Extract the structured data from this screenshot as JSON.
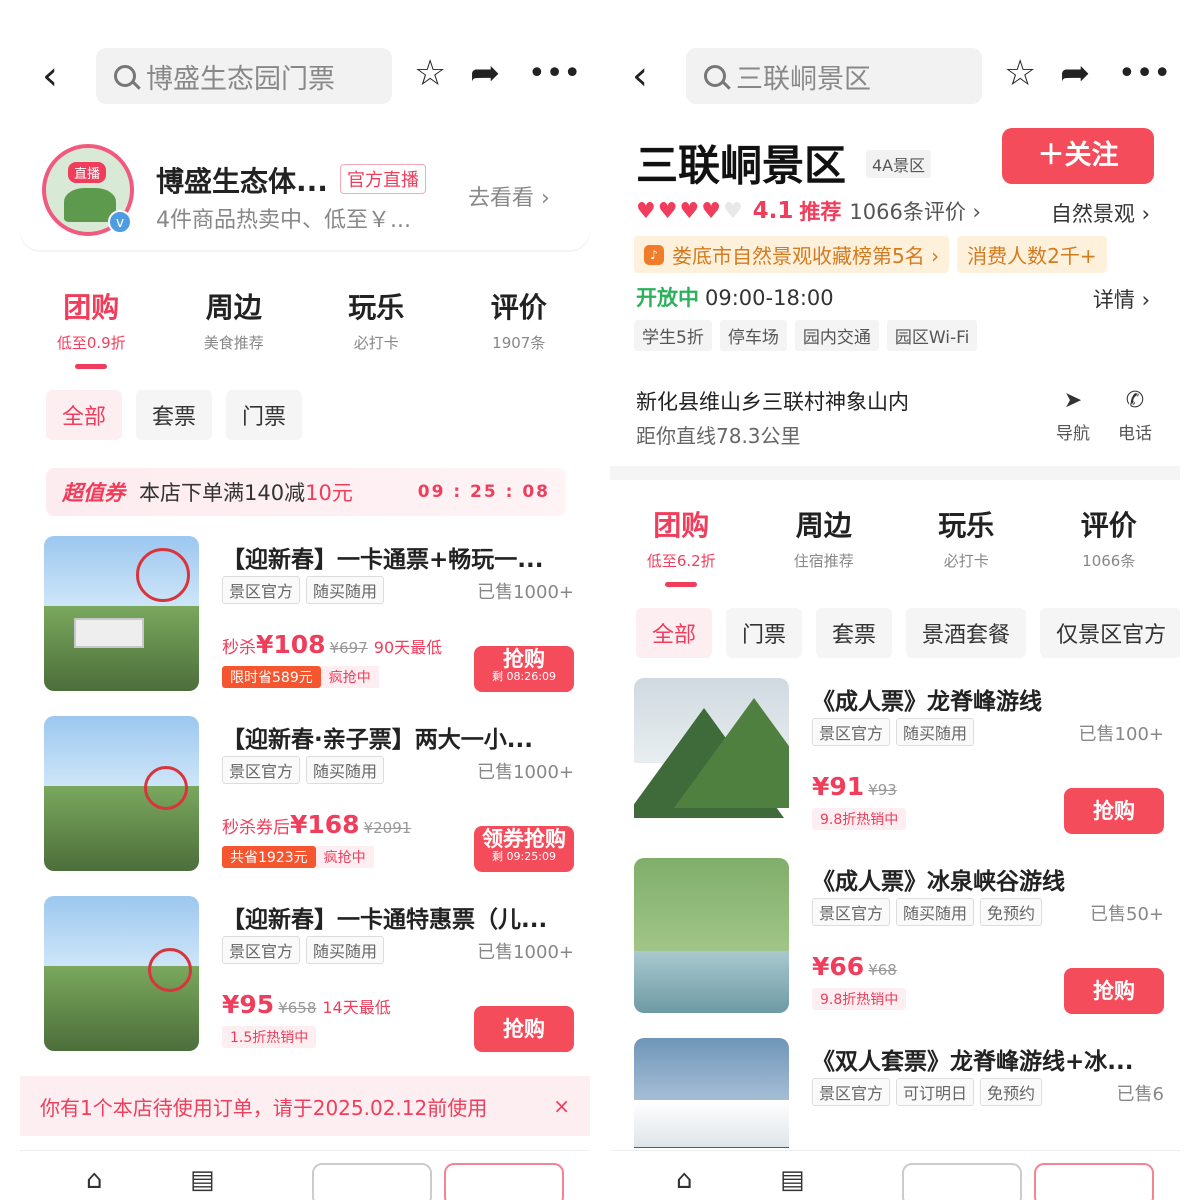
{
  "left": {
    "search_text": "博盛生态园门票",
    "live": {
      "badge": "直播",
      "title": "博盛生态体...",
      "tag": "官方直播",
      "subtitle": "4件商品热卖中、低至￥...",
      "go": "去看看 ›"
    },
    "tabs": [
      {
        "label": "团购",
        "sub": "低至0.9折"
      },
      {
        "label": "周边",
        "sub": "美食推荐"
      },
      {
        "label": "玩乐",
        "sub": "必打卡"
      },
      {
        "label": "评价",
        "sub": "1907条"
      }
    ],
    "filters": [
      "全部",
      "套票",
      "门票"
    ],
    "coupon": {
      "brand": "超值券",
      "text": "本店下单满140减",
      "amount": "10元",
      "timer": "09 : 25 : 08"
    },
    "products": [
      {
        "title": "【迎新春】一卡通票+畅玩一...",
        "tags": [
          "景区官方",
          "随买随用"
        ],
        "sold": "已售1000+",
        "price_prefix": "秒杀",
        "price": "¥108",
        "old": "¥697",
        "note": "90天最低",
        "badge1": "限时省589元",
        "badge2": "疯抢中",
        "buy": "抢购",
        "buy_sub": "剩 08:26:09"
      },
      {
        "title": "【迎新春·亲子票】两大一小...",
        "tags": [
          "景区官方",
          "随买随用"
        ],
        "sold": "已售1000+",
        "price_prefix": "秒杀券后",
        "price": "¥168",
        "old": "¥2091",
        "note": "",
        "badge1": "共省1923元",
        "badge2": "疯抢中",
        "buy": "领券抢购",
        "buy_sub": "剩 09:25:09"
      },
      {
        "title": "【迎新春】一卡通特惠票（儿...",
        "tags": [
          "景区官方",
          "随买随用"
        ],
        "sold": "已售1000+",
        "price_prefix": "",
        "price": "¥95",
        "old": "¥658",
        "note": "14天最低",
        "badge1": "1.5折热销中",
        "buy": "抢购"
      }
    ],
    "notice": "你有1个本店待使用订单，请于2025.02.12前使用",
    "close": "×"
  },
  "right": {
    "search_text": "三联峒景区",
    "title": "三联峒景区",
    "level": "4A景区",
    "follow": "＋关注",
    "hearts_filled": 4,
    "hearts_total": 5,
    "score": "4.1",
    "recommend": "推荐",
    "reviews": "1066条评价 ›",
    "category": "自然景观 ›",
    "rank": "娄底市自然景观收藏榜第5名 ›",
    "consumers": "消费人数2千+",
    "open_label": "开放中",
    "open_hours": "09:00-18:00",
    "detail": "详情 ›",
    "facilities": [
      "学生5折",
      "停车场",
      "园内交通",
      "园区Wi-Fi"
    ],
    "address": "新化县维山乡三联村神象山内",
    "distance": "距你直线78.3公里",
    "nav": "导航",
    "phone": "电话",
    "tabs": [
      {
        "label": "团购",
        "sub": "低至6.2折"
      },
      {
        "label": "周边",
        "sub": "住宿推荐"
      },
      {
        "label": "玩乐",
        "sub": "必打卡"
      },
      {
        "label": "评价",
        "sub": "1066条"
      }
    ],
    "filters": [
      "全部",
      "门票",
      "套票",
      "景酒套餐",
      "仅景区官方"
    ],
    "products": [
      {
        "title": "《成人票》龙脊峰游线",
        "tags": [
          "景区官方",
          "随买随用"
        ],
        "sold": "已售100+",
        "price": "¥91",
        "old": "¥93",
        "badge": "9.8折热销中",
        "buy": "抢购"
      },
      {
        "title": "《成人票》冰泉峡谷游线",
        "tags": [
          "景区官方",
          "随买随用",
          "免预约"
        ],
        "sold": "已售50+",
        "price": "¥66",
        "old": "¥68",
        "badge": "9.8折热销中",
        "buy": "抢购"
      },
      {
        "title": "《双人套票》龙脊峰游线+冰...",
        "tags": [
          "景区官方",
          "可订明日",
          "免预约"
        ],
        "sold": "已售6"
      }
    ]
  },
  "colors": {
    "accent": "#f03d5b",
    "buy": "#f54c5b",
    "open": "#2bb15b",
    "rank": "#d47a1f"
  }
}
